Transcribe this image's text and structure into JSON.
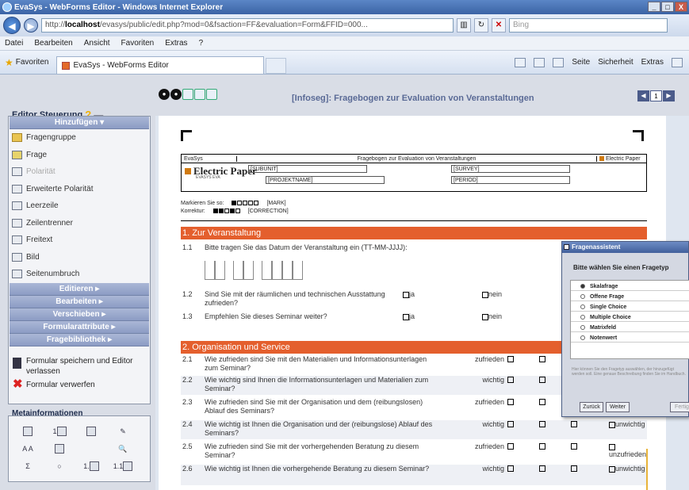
{
  "window": {
    "title": "EvaSys - WebForms Editor - Windows Internet Explorer",
    "controls": [
      "_",
      "□",
      "X"
    ]
  },
  "address": {
    "url_prefix": "http://",
    "url_host": "localhost",
    "url_rest": "/evasys/public/edit.php?mod=0&fsaction=FF&evaluation=Form&FFID=000...",
    "search_placeholder": "Bing"
  },
  "menu": [
    "Datei",
    "Bearbeiten",
    "Ansicht",
    "Favoriten",
    "Extras",
    "?"
  ],
  "favorites": {
    "label": "Favoriten",
    "tab_label": "EvaSys - WebForms Editor",
    "commands": [
      "Seite",
      "Sicherheit",
      "Extras"
    ]
  },
  "editor": {
    "title": "Editor Steuerung",
    "add_header": "Hinzufügen",
    "tools": [
      {
        "label": "Fragengruppe",
        "icon": "folder-icon",
        "disabled": false
      },
      {
        "label": "Frage",
        "icon": "question-pen-icon",
        "disabled": false
      },
      {
        "label": "Polarität",
        "icon": "polarity-icon",
        "disabled": true
      },
      {
        "label": "Erweiterte Polarität",
        "icon": "extended-polarity-icon",
        "disabled": false
      },
      {
        "label": "Leerzeile",
        "icon": "blank-line-icon",
        "disabled": false
      },
      {
        "label": "Zeilentrenner",
        "icon": "line-separator-icon",
        "disabled": false
      },
      {
        "label": "Freitext",
        "icon": "freetext-icon",
        "disabled": false
      },
      {
        "label": "Bild",
        "icon": "image-icon",
        "disabled": false
      },
      {
        "label": "Seitenumbruch",
        "icon": "page-break-icon",
        "disabled": false
      }
    ],
    "sections": [
      "Editieren",
      "Bearbeiten",
      "Verschieben",
      "Formularattribute",
      "Fragebibliothek"
    ],
    "actions": {
      "save": "Formular speichern und Editor verlassen",
      "discard": "Formular verwerfen"
    }
  },
  "meta": {
    "title": "Metainformationen",
    "icons": [
      "gear-icon",
      "page-number-icon",
      "page-icon",
      "pencil-icon",
      "font-size-icon",
      "table-icon",
      "magnifier-icon",
      "sum-icon",
      "circle-icon",
      "page-grid-icon",
      "page-list-icon"
    ]
  },
  "doc": {
    "title": "[Infoseg]: Fragebogen zur Evaluation von Veranstaltungen",
    "page_label": "1"
  },
  "form_header": {
    "brand": "EvaSys",
    "title": "Fragebogen zur Evaluation von Veranstaltungen",
    "logo_text": "Electric Paper",
    "logo_right": "Electric Paper",
    "logo_sub": "EVASYS EVA",
    "fields": [
      "[SUBUNIT]",
      "[SURVEY]",
      "[PROJEKTNAME]",
      "[PERIOD]"
    ],
    "mark_label": "Markieren Sie so:",
    "correct_label": "Korrektur:",
    "mark_value": "[MARK]",
    "correct_value": "[CORRECTION]"
  },
  "section1": {
    "title": "1. Zur Veranstaltung",
    "questions": [
      {
        "num": "1.1",
        "text": "Bitte tragen Sie das Datum der Veranstaltung ein (TT-MM-JJJJ):"
      },
      {
        "num": "1.2",
        "text": "Sind Sie mit der räumlichen und technischen Ausstattung zufrieden?",
        "yes": "ja",
        "no": "nein"
      },
      {
        "num": "1.3",
        "text": "Empfehlen Sie dieses Seminar weiter?",
        "yes": "ja",
        "no": "nein"
      }
    ]
  },
  "section2": {
    "title": "2. Organisation und Service",
    "questions": [
      {
        "num": "2.1",
        "text": "Wie zufrieden sind Sie mit den Materialien und Informationsunterlagen zum Seminar?",
        "left": "zufrieden",
        "right": ""
      },
      {
        "num": "2.2",
        "text": "Wie wichtig sind Ihnen die Informationsunterlagen und Materialien zum Seminar?",
        "left": "wichtig",
        "right": ""
      },
      {
        "num": "2.3",
        "text": "Wie zufrieden sind Sie mit der Organisation und dem (reibungslosen) Ablauf des Seminars?",
        "left": "zufrieden",
        "right": ""
      },
      {
        "num": "2.4",
        "text": "Wie wichtig ist Ihnen die Organisation und der (reibungslose) Ablauf des Seminars?",
        "left": "wichtig",
        "right": "unwichtig"
      },
      {
        "num": "2.5",
        "text": "Wie zufrieden sind Sie mit der vorhergehenden Beratung zu diesem Seminar?",
        "left": "zufrieden",
        "right": "unzufrieden"
      },
      {
        "num": "2.6",
        "text": "Wie wichtig ist Ihnen die vorhergehende Beratung zu diesem Seminar?",
        "left": "wichtig",
        "right": "unwichtig"
      }
    ]
  },
  "dialog": {
    "title": "Fragenassistent",
    "prompt": "Bitte wählen Sie einen Fragetyp",
    "options": [
      "Skalafrage",
      "Offene Frage",
      "Single Choice",
      "Multiple Choice",
      "Matrixfeld",
      "Notenwert"
    ],
    "selected_index": 0,
    "help": "Hier können Sie den Fragetyp auswählen, der hinzugefügt werden soll. Eine genaue Beschreibung finden Sie im Handbuch.",
    "buttons": [
      "Zurück",
      "Weiter",
      "Fertig"
    ]
  }
}
